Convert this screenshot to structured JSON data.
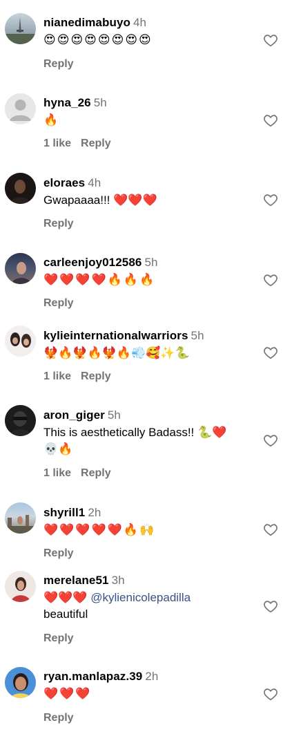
{
  "comments": [
    {
      "username": "nianedimabuyo",
      "time": "4h",
      "text": "😍😍😍😍😍😍😍😍",
      "likes": "",
      "reply": "Reply"
    },
    {
      "username": "hyna_26",
      "time": "5h",
      "text": "🔥",
      "likes": "1 like",
      "reply": "Reply"
    },
    {
      "username": "eloraes",
      "time": "4h",
      "text": "Gwapaaaa!!! ❤️❤️❤️",
      "likes": "",
      "reply": "Reply"
    },
    {
      "username": "carleenjoy012586",
      "time": "5h",
      "text": "❤️❤️❤️❤️🔥🔥🔥",
      "likes": "",
      "reply": "Reply"
    },
    {
      "username": "kylieinternationalwarriors",
      "time": "5h",
      "text": "🐦‍🔥🔥🐦‍🔥🔥🐦‍🔥🔥💨🥰✨🐍",
      "likes": "1 like",
      "reply": "Reply"
    },
    {
      "username": "aron_giger",
      "time": "5h",
      "text": "This is aesthetically Badass!! 🐍❤️\n💀🔥",
      "likes": "1 like",
      "reply": "Reply"
    },
    {
      "username": "shyrill1",
      "time": "2h",
      "text": "❤️❤️❤️❤️❤️🔥🙌",
      "likes": "",
      "reply": "Reply"
    },
    {
      "username": "merelane51",
      "time": "3h",
      "text_prefix": "❤️❤️❤️ ",
      "mention": "@kylienicolepadilla",
      "text_suffix": "beautiful",
      "likes": "",
      "reply": "Reply"
    },
    {
      "username": "ryan.manlapaz.39",
      "time": "2h",
      "text": "❤️❤️❤️",
      "likes": "",
      "reply": "Reply"
    }
  ],
  "colors": {
    "muted": "#737373",
    "mention": "#385185",
    "heart_outline": "#737373"
  },
  "icons": {
    "like": "heart-outline-icon",
    "avatar_default": "default-avatar-icon"
  }
}
